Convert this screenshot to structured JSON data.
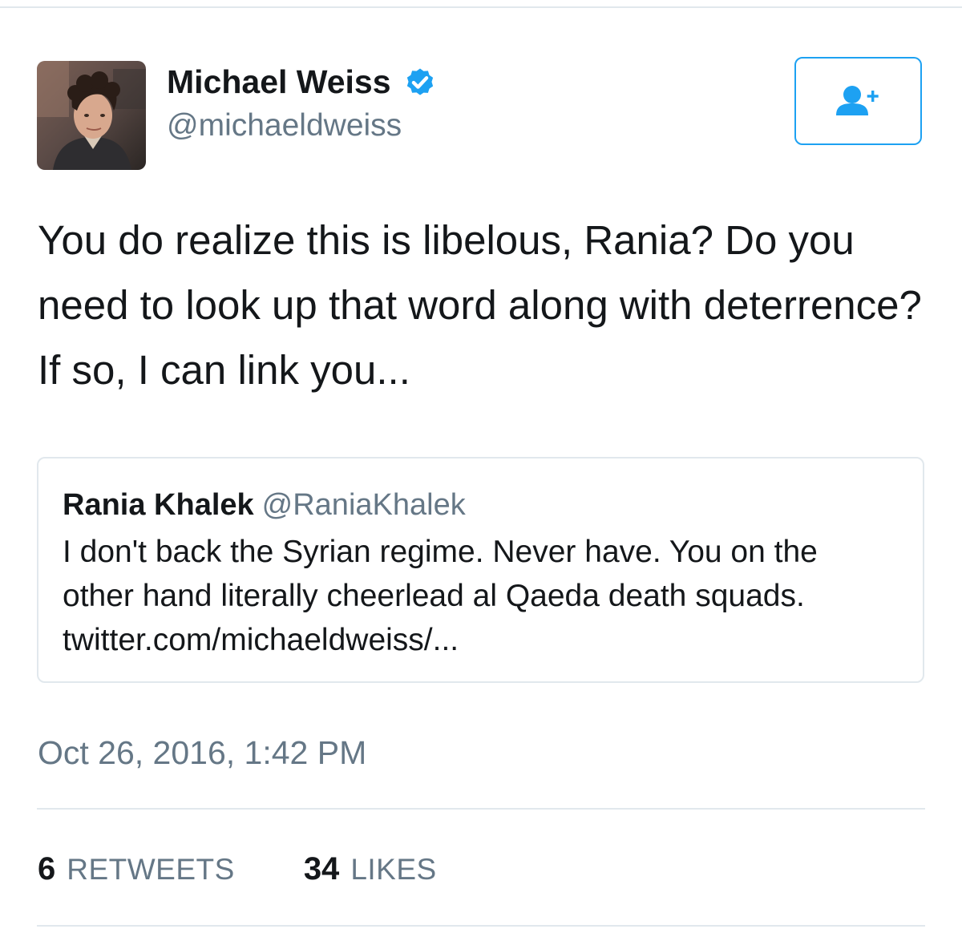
{
  "tweet": {
    "author": {
      "display_name": "Michael Weiss",
      "handle": "@michaeldweiss",
      "verified": true,
      "avatar_icon": "avatar-photo"
    },
    "follow_button_icon": "follow-user-icon",
    "text": "You do realize this is libelous, Rania? Do you need to look up that word along with deterrence? If so, I can link you...",
    "quoted_tweet": {
      "author_name": "Rania Khalek",
      "author_handle": "@RaniaKhalek",
      "text": "I don't back the Syrian regime. Never have. You on the other hand literally cheerlead al Qaeda death squads. twitter.com/michaeldweiss/..."
    },
    "timestamp": "Oct 26, 2016, 1:42 PM",
    "stats": {
      "retweets_count": "6",
      "retweets_label": "RETWEETS",
      "likes_count": "34",
      "likes_label": "LIKES"
    }
  },
  "colors": {
    "accent": "#1da1f2",
    "text": "#14171a",
    "secondary_text": "#657786",
    "border": "#e1e8ed"
  }
}
